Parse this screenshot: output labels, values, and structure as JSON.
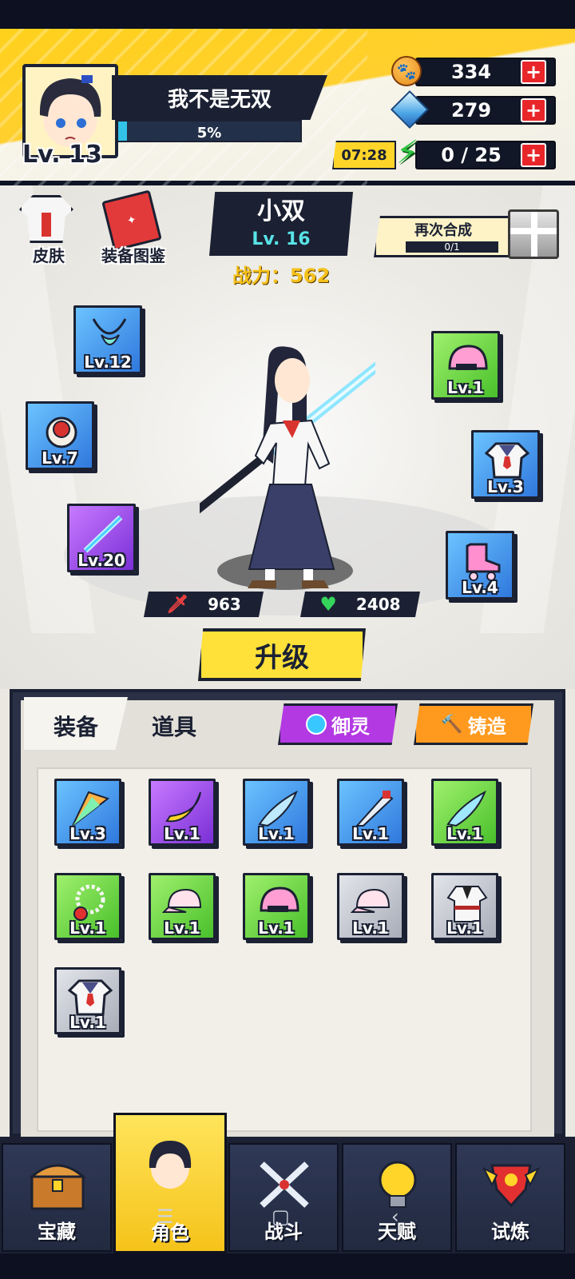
{
  "player": {
    "name": "我不是无双",
    "level": "Lv. 13",
    "exp_text": "5%",
    "exp_fraction": 0.05
  },
  "resources": {
    "gold": "334",
    "gems": "279",
    "energy": "0 / 25",
    "energy_timer": "07:28",
    "plus_label": "+"
  },
  "top_shortcuts": {
    "skin_label": "皮肤",
    "catalog_label": "装备图鉴"
  },
  "hero": {
    "name": "小双",
    "level": "Lv. 16",
    "power": "战力：562",
    "attack": "963",
    "health": "2408"
  },
  "merge": {
    "label": "再次合成",
    "progress": "0/1"
  },
  "equipped": {
    "left": [
      {
        "level": "Lv.12",
        "rarity": "blue",
        "item": "necklace"
      },
      {
        "level": "Lv.7",
        "rarity": "blue",
        "item": "ring"
      },
      {
        "level": "Lv.20",
        "rarity": "purple",
        "item": "light-sword"
      }
    ],
    "right": [
      {
        "level": "Lv.1",
        "rarity": "green",
        "item": "helmet"
      },
      {
        "level": "Lv.3",
        "rarity": "blue",
        "item": "uniform"
      },
      {
        "level": "Lv.4",
        "rarity": "blue",
        "item": "roller-skate"
      }
    ]
  },
  "upgrade_label": "升级",
  "tabs": {
    "equipment": "装备",
    "items": "道具",
    "spirit": "御灵",
    "forge": "铸造"
  },
  "inventory": [
    {
      "level": "Lv.3",
      "rarity": "blue",
      "item": "crystal-fan"
    },
    {
      "level": "Lv.1",
      "rarity": "purple",
      "item": "banana-blade"
    },
    {
      "level": "Lv.1",
      "rarity": "blue",
      "item": "scythe-blade"
    },
    {
      "level": "Lv.1",
      "rarity": "blue",
      "item": "machete"
    },
    {
      "level": "Lv.1",
      "rarity": "green",
      "item": "scythe-blade"
    },
    {
      "level": "Lv.1",
      "rarity": "green",
      "item": "bead-necklace"
    },
    {
      "level": "Lv.1",
      "rarity": "green",
      "item": "cap"
    },
    {
      "level": "Lv.1",
      "rarity": "green",
      "item": "helmet"
    },
    {
      "level": "Lv.1",
      "rarity": "grey",
      "item": "cap"
    },
    {
      "level": "Lv.1",
      "rarity": "grey",
      "item": "robe"
    },
    {
      "level": "Lv.1",
      "rarity": "grey",
      "item": "uniform"
    }
  ],
  "nav": {
    "treasure": "宝藏",
    "role": "角色",
    "battle": "战斗",
    "talent": "天赋",
    "trial": "试炼"
  },
  "colors": {
    "accent_yellow": "#ffd11c",
    "dark_navy": "#1b2133",
    "rarity_blue": "#2f78dd",
    "rarity_green": "#49c02b",
    "rarity_purple": "#7a2fd6",
    "rarity_grey": "#a9adb8",
    "plus_red": "#e8262a"
  }
}
